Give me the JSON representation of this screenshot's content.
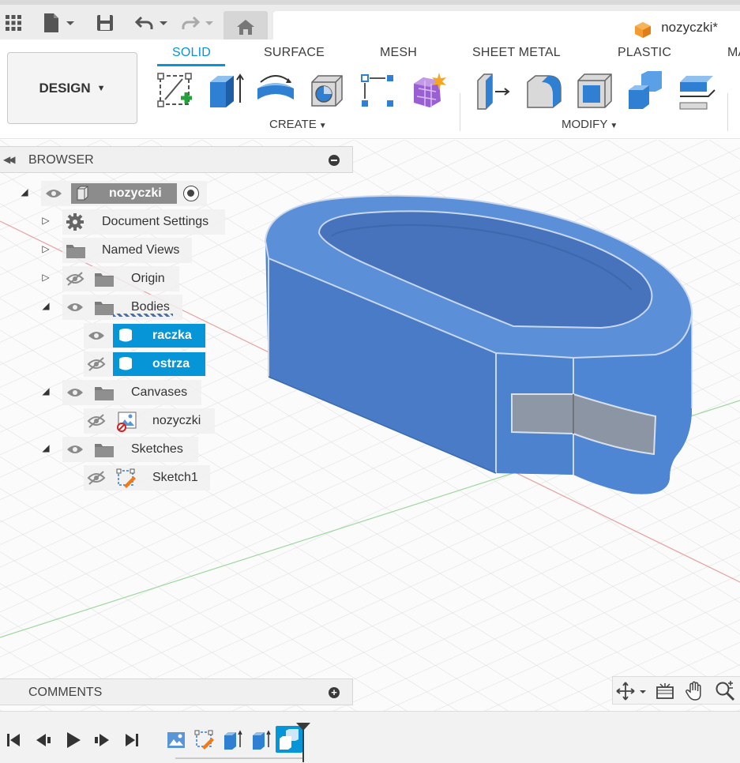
{
  "titlebar": {
    "document_name": "nozyczki*",
    "icons": [
      "grid-apps-icon",
      "file-icon",
      "save-icon",
      "undo-icon",
      "redo-icon",
      "home-icon"
    ]
  },
  "toolbar": {
    "workspace_label": "DESIGN",
    "tabs": [
      {
        "label": "SOLID",
        "active": true
      },
      {
        "label": "SURFACE",
        "active": false
      },
      {
        "label": "MESH",
        "active": false
      },
      {
        "label": "SHEET METAL",
        "active": false
      },
      {
        "label": "PLASTIC",
        "active": false
      },
      {
        "label": "MA",
        "active": false
      }
    ],
    "groups": {
      "create": "CREATE",
      "modify": "MODIFY"
    },
    "create_tools": [
      "create-sketch-icon",
      "extrude-icon",
      "revolve-icon",
      "hole-icon",
      "rectangular-pattern-icon",
      "create-form-icon"
    ],
    "modify_tools": [
      "press-pull-icon",
      "fillet-icon",
      "shell-icon",
      "combine-icon",
      "offset-face-icon"
    ]
  },
  "browser": {
    "title": "BROWSER",
    "root": "nozyczki",
    "items": [
      {
        "label": "Document Settings"
      },
      {
        "label": "Named Views"
      },
      {
        "label": "Origin"
      },
      {
        "label": "Bodies"
      },
      {
        "label": "raczka"
      },
      {
        "label": "ostrza"
      },
      {
        "label": "Canvases"
      },
      {
        "label": "nozyczki"
      },
      {
        "label": "Sketches"
      },
      {
        "label": "Sketch1"
      }
    ]
  },
  "comments": {
    "title": "COMMENTS"
  },
  "colors": {
    "accent": "#0696d7",
    "body_blue": "#4a86d8",
    "toolbar_bg": "#ffffff",
    "panel_bg": "#f0f0f0"
  }
}
